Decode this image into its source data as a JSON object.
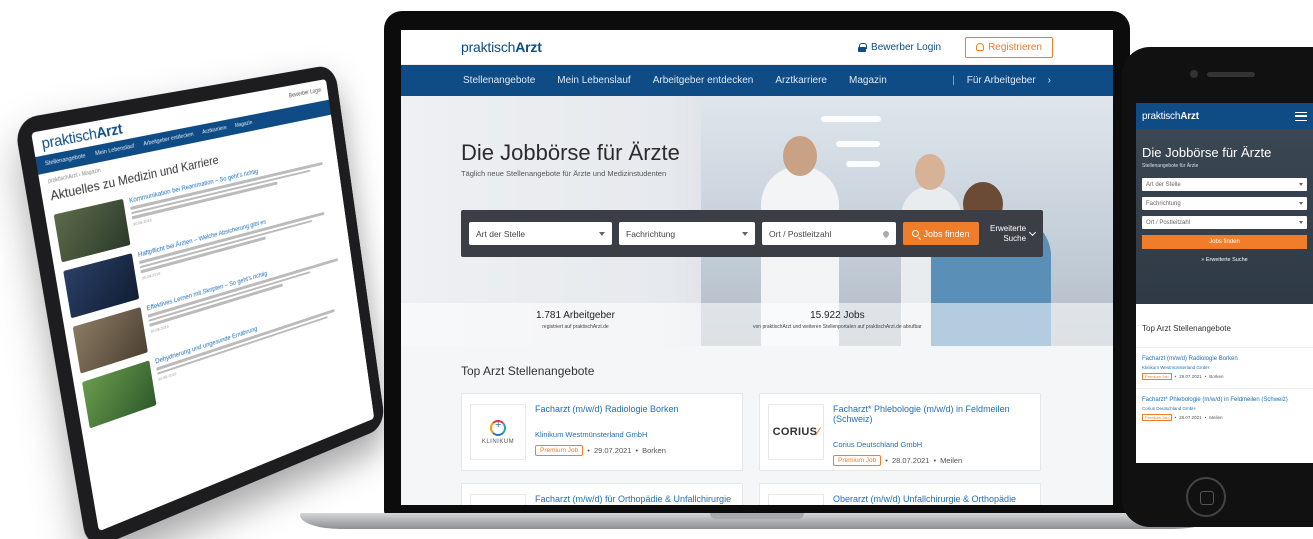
{
  "brand": {
    "prefix": "praktisch",
    "bold": "Arzt"
  },
  "colors": {
    "primary": "#0f4c85",
    "accent": "#f07d2a",
    "link": "#1e6fb8"
  },
  "header": {
    "login": "Bewerber Login",
    "register": "Registrieren"
  },
  "nav": {
    "items": [
      "Stellenangebote",
      "Mein Lebenslauf",
      "Arbeitgeber entdecken",
      "Arztkarriere",
      "Magazin"
    ],
    "employer": "Für Arbeitgeber",
    "employer_sep": "|",
    "employer_arrow": "›"
  },
  "hero": {
    "title": "Die Jobbörse für Ärzte",
    "subtitle": "Täglich neue Stellenangebote für Ärzte und Medizinstudenten"
  },
  "search": {
    "position_placeholder": "Art der Stelle",
    "specialty_placeholder": "Fachrichtung",
    "location_placeholder": "Ort / Postleitzahl",
    "button": "Jobs finden",
    "advanced_line1": "Erweiterte",
    "advanced_line2": "Suche"
  },
  "stats": [
    {
      "number": "1.781 Arbeitgeber",
      "label": "registriert auf praktischArzt.de"
    },
    {
      "number": "15.922 Jobs",
      "label": "von praktischArzt und weiteren Stellenportalen auf praktischArzt.de abrufbar"
    }
  ],
  "top_jobs": {
    "title": "Top Arzt Stellenangebote",
    "jobs": [
      {
        "title": "Facharzt (m/w/d) Radiologie Borken",
        "company": "Klinikum Westmünsterland GmbH",
        "badge": "Premium Job",
        "date": "29.07.2021",
        "city": "Borken",
        "logo": "KLINIKUM"
      },
      {
        "title": "Facharzt* Phlebologie (m/w/d) in Feldmeilen (Schweiz)",
        "company": "Corius Deutschland GmbH",
        "badge": "Premium Job",
        "date": "28.07.2021",
        "city": "Meilen",
        "logo": "CORIUS"
      },
      {
        "title": "Facharzt (m/w/d) für Orthopädie & Unfallchirurgie"
      },
      {
        "title": "Oberarzt (m/w/d) Unfallchirurgie & Orthopädie"
      }
    ]
  },
  "tablet": {
    "login": "Bewerber Login",
    "nav": [
      "Stellenangebote",
      "Mein Lebenslauf",
      "Arbeitgeber entdecken",
      "Arztkarriere",
      "Magazin"
    ],
    "breadcrumb": "praktischArzt › Magazin",
    "heading": "Aktuelles zu Medizin und Karriere",
    "articles": [
      {
        "title": "Kommunikation bei Reanimation – So geht's richtig",
        "date": "30.08.2019"
      },
      {
        "title": "Haftpflicht bei Ärzten – Welche Absicherung gibt es",
        "date": "30.08.2019"
      },
      {
        "title": "Effektives Lernen mit Skripten – So geht's richtig",
        "date": "30.08.2019"
      },
      {
        "title": "Dehydrierung und ungesunde Ernährung",
        "date": "30.08.2019"
      }
    ]
  },
  "phone": {
    "hero_title": "Die Jobbörse für Ärzte",
    "hero_sub": "Stellenangebote für Ärzte",
    "position_placeholder": "Art der Stelle",
    "specialty_placeholder": "Fachrichtung",
    "location_placeholder": "Ort / Postleitzahl",
    "button": "Jobs finden",
    "advanced": "» Erweiterte Suche",
    "section": "Top Arzt Stellenangebote",
    "jobs": [
      {
        "title": "Facharzt (m/w/d) Radiologie Borken",
        "company": "Klinikum Westmünsterland GmbH",
        "badge": "Premium Job",
        "date": "29.07.2021",
        "city": "Borken"
      },
      {
        "title": "Facharzt* Phlebologie (m/w/d) in Feldmeilen (Schweiz)",
        "company": "Corius Deutschland GmbH",
        "badge": "Premium Job",
        "date": "28.07.2021",
        "city": "Meilen"
      }
    ]
  }
}
